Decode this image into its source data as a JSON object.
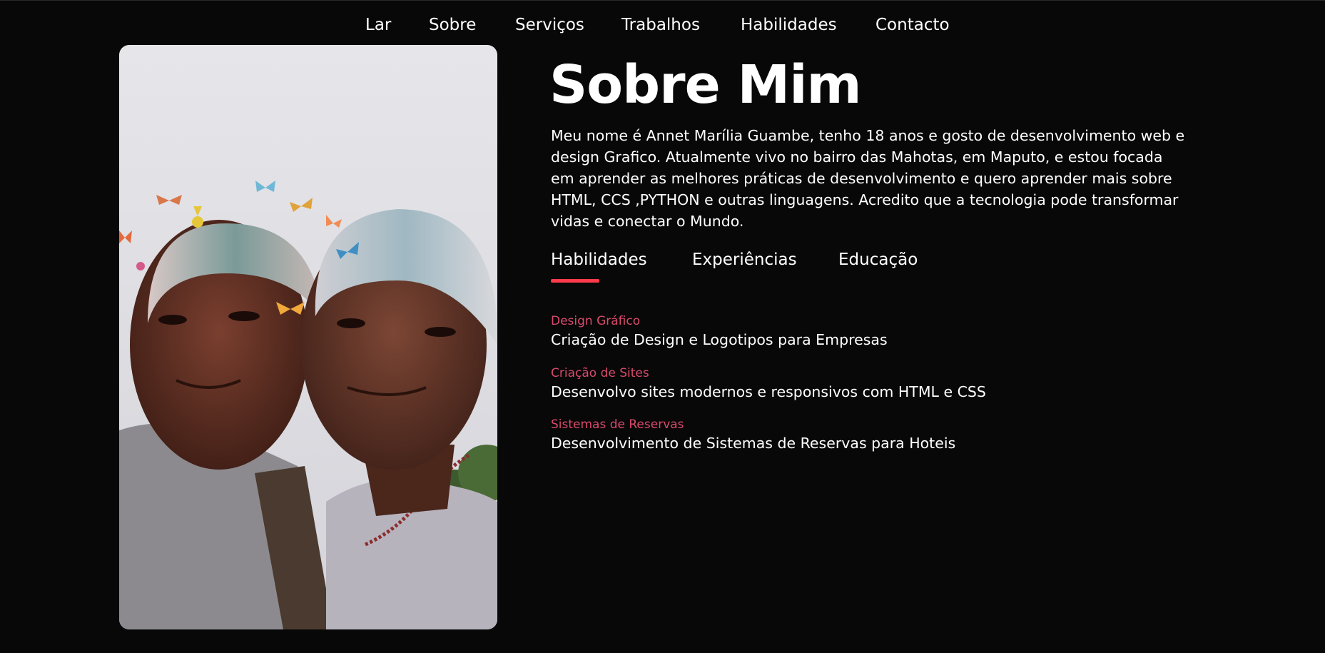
{
  "nav": {
    "items": [
      {
        "label": "Lar"
      },
      {
        "label": "Sobre"
      },
      {
        "label": "Serviços"
      },
      {
        "label": "Trabalhos"
      },
      {
        "label": "Habilidades"
      },
      {
        "label": "Contacto"
      }
    ]
  },
  "about": {
    "title": "Sobre Mim",
    "paragraph": "Meu nome é Annet Marília Guambe, tenho 18 anos e gosto de desenvolvimento web e design Grafico. Atualmente vivo no bairro das Mahotas, em Maputo, e estou focada em aprender as melhores práticas de desenvolvimento e quero aprender mais sobre HTML, CCS ,PYTHON e outras linguagens. Acredito que a tecnologia pode transformar vidas e conectar o Mundo.",
    "tabs": [
      {
        "label": "Habilidades",
        "active": true
      },
      {
        "label": "Experiências",
        "active": false
      },
      {
        "label": "Educação",
        "active": false
      }
    ],
    "skills": [
      {
        "title": "Design Gráfico",
        "desc": "Criação de Design e Logotipos para Empresas"
      },
      {
        "title": "Criação de Sites",
        "desc": "Desenvolvo sites modernos e responsivos com HTML e CSS"
      },
      {
        "title": "Sistemas de Reservas",
        "desc": "Desenvolvimento de Sistemas de Reservas para Hoteis"
      }
    ]
  },
  "colors": {
    "background": "#080808",
    "accent": "#ff3a4a",
    "skill_title": "#d94a6c",
    "text": "#ffffff"
  },
  "photo": {
    "icon": "profile-photo"
  }
}
